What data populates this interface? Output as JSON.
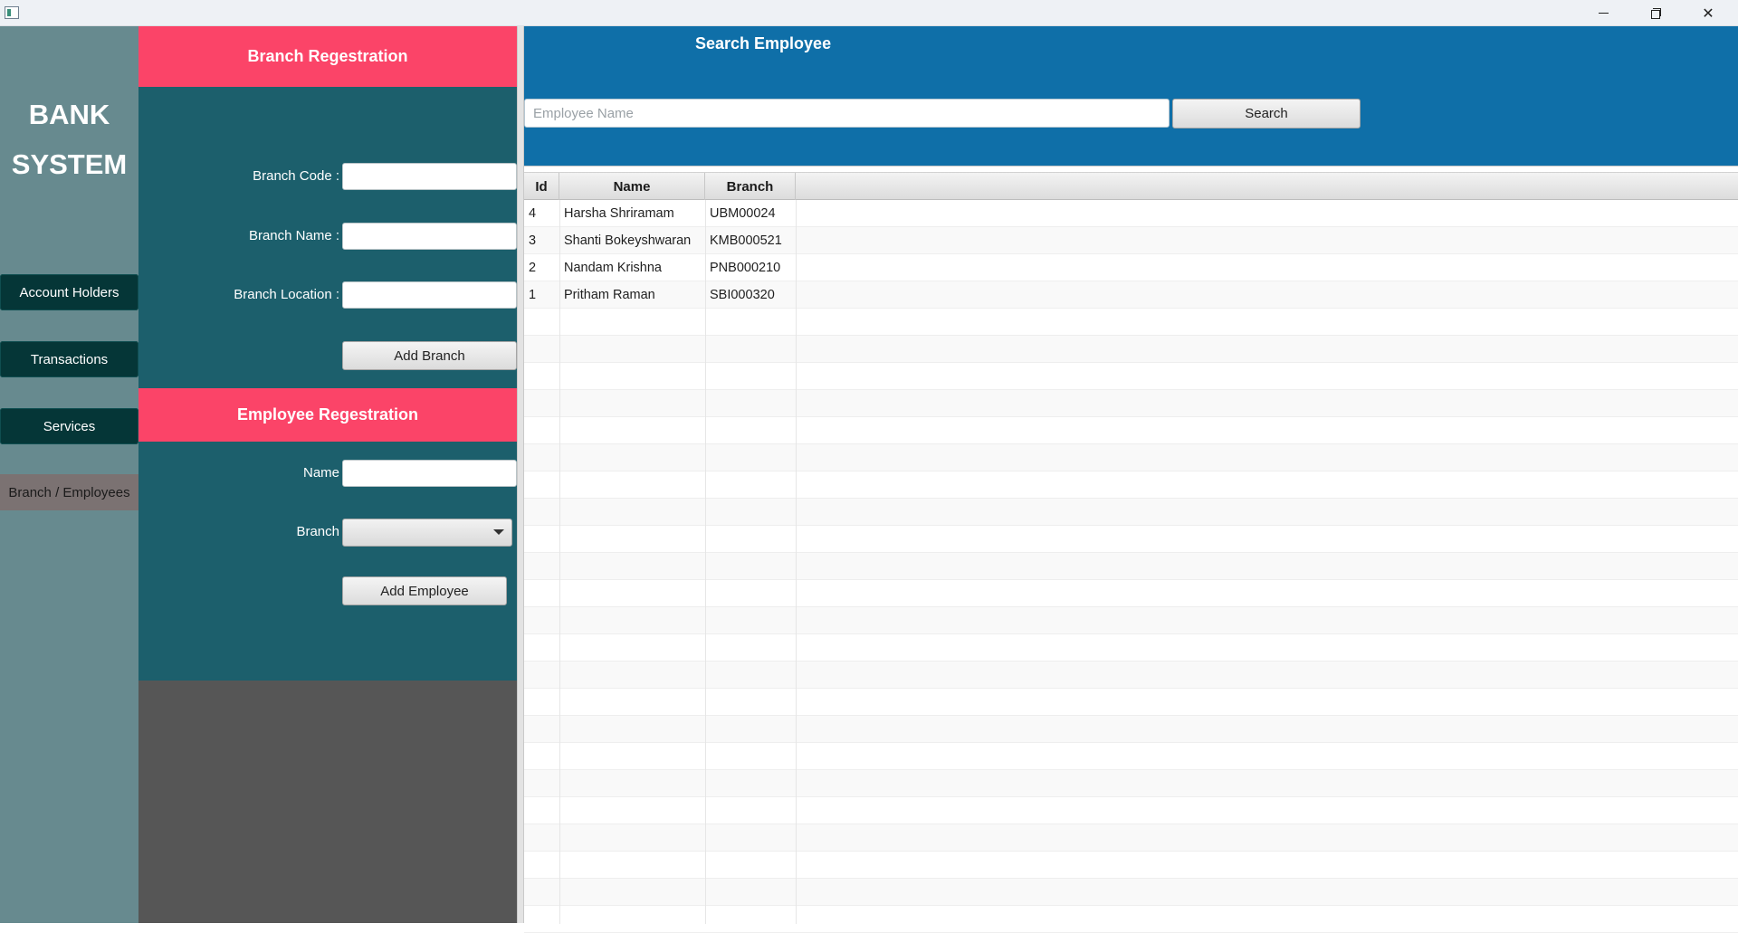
{
  "window": {
    "title": ""
  },
  "sidebar": {
    "app_title_line1": "BANK",
    "app_title_line2": "SYSTEM",
    "items": [
      {
        "label": "Account Holders"
      },
      {
        "label": "Transactions"
      },
      {
        "label": "Services"
      },
      {
        "label": "Branch / Employees"
      }
    ]
  },
  "branch_form": {
    "header": "Branch Regestration",
    "code_label": "Branch Code :",
    "code_value": "",
    "name_label": "Branch Name :",
    "name_value": "",
    "location_label": "Branch Location :",
    "location_value": "",
    "add_button": "Add Branch"
  },
  "employee_form": {
    "header": "Employee Regestration",
    "name_label": "Name",
    "name_value": "",
    "branch_label": "Branch",
    "branch_selected": "",
    "add_button": "Add Employee"
  },
  "search": {
    "title": "Search Employee",
    "placeholder": "Employee Name",
    "value": "",
    "button": "Search"
  },
  "table": {
    "columns": [
      "Id",
      "Name",
      "Branch"
    ],
    "rows": [
      {
        "id": "4",
        "name": "Harsha Shriramam",
        "branch": "UBM00024"
      },
      {
        "id": "3",
        "name": "Shanti Bokeyshwaran",
        "branch": "KMB000521"
      },
      {
        "id": "2",
        "name": "Nandam Krishna",
        "branch": "PNB000210"
      },
      {
        "id": "1",
        "name": "Pritham Raman",
        "branch": "SBI000320"
      }
    ]
  },
  "colors": {
    "sidebar": "#678a8f",
    "nav_button": "#053637",
    "nav_selected": "#7b7272",
    "form_panel": "#1c5f6c",
    "section_header": "#fb4468",
    "search_panel": "#0f6fa8"
  }
}
